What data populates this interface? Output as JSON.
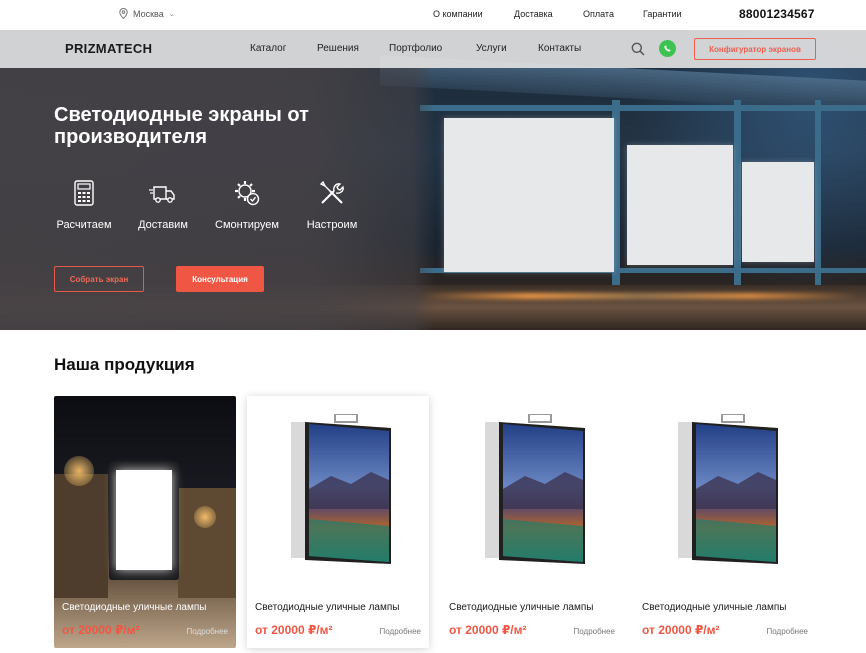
{
  "topbar": {
    "city": "Москва",
    "links": [
      "О компании",
      "Доставка",
      "Оплата",
      "Гарантии"
    ],
    "phone": "88001234567"
  },
  "nav": {
    "logo": "PRIZMATECH",
    "items": [
      "Каталог",
      "Решения",
      "Портфолио",
      "Услуги",
      "Контакты"
    ],
    "config_button": "Конфигуратор экранов"
  },
  "hero": {
    "title": "Светодиодные экраны от производителя",
    "features": [
      {
        "label": "Расчитаем",
        "icon": "calculator-icon"
      },
      {
        "label": "Доставим",
        "icon": "delivery-truck-icon"
      },
      {
        "label": "Смонтируем",
        "icon": "gear-check-icon"
      },
      {
        "label": "Настроим",
        "icon": "tools-icon"
      }
    ],
    "btn_build": "Собрать экран",
    "btn_consult": "Консультация"
  },
  "products": {
    "title": "Наша продукция",
    "items": [
      {
        "title": "Светодиодные уличные лампы",
        "price": "от 20000 ₽/м²",
        "more": "Подробнее"
      },
      {
        "title": "Светодиодные уличные лампы",
        "price": "от 20000 ₽/м²",
        "more": "Подробнее"
      },
      {
        "title": "Светодиодные уличные лампы",
        "price": "от 20000 ₽/м²",
        "more": "Подробнее"
      },
      {
        "title": "Светодиодные уличные лампы",
        "price": "от 20000 ₽/м²",
        "more": "Подробнее"
      }
    ]
  },
  "colors": {
    "accent": "#ef5744",
    "whatsapp": "#3fc350",
    "hero_overlay": "#464246"
  }
}
